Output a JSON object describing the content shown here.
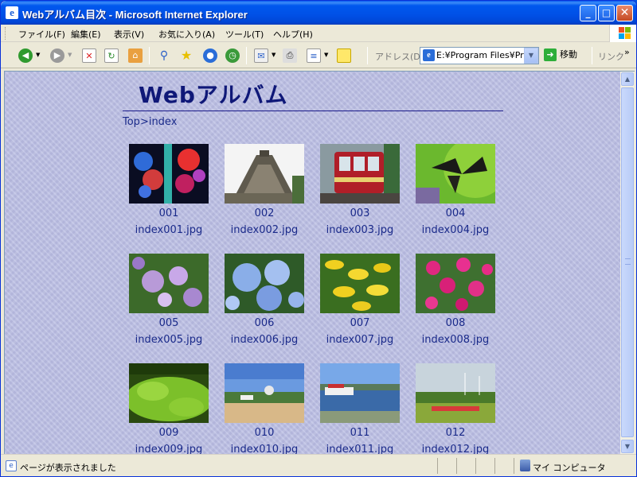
{
  "window": {
    "title": "Webアルバム目次 - Microsoft Internet Explorer",
    "icon": "ie-icon",
    "controls": {
      "minimize": "_",
      "maximize": "□",
      "close": "✕"
    }
  },
  "menu": {
    "items": [
      {
        "label": "ファイル(F)"
      },
      {
        "label": "編集(E)"
      },
      {
        "label": "表示(V)"
      },
      {
        "label": "お気に入り(A)"
      },
      {
        "label": "ツール(T)"
      },
      {
        "label": "ヘルプ(H)"
      }
    ]
  },
  "toolbar": {
    "address_label": "アドレス(D)",
    "address_value": "E:¥Program Files¥Pre",
    "go_label": "移動",
    "links_label": "リンク",
    "more": "»"
  },
  "page": {
    "title": "Webアルバム",
    "breadcrumb": "Top>index",
    "items": [
      {
        "num": "001",
        "file": "index001.jpg",
        "theme": "lights"
      },
      {
        "num": "002",
        "file": "index002.jpg",
        "theme": "pyramid"
      },
      {
        "num": "003",
        "file": "index003.jpg",
        "theme": "tram"
      },
      {
        "num": "004",
        "file": "index004.jpg",
        "theme": "butterfly"
      },
      {
        "num": "005",
        "file": "index005.jpg",
        "theme": "hydrangea-purple"
      },
      {
        "num": "006",
        "file": "index006.jpg",
        "theme": "hydrangea-blue"
      },
      {
        "num": "007",
        "file": "index007.jpg",
        "theme": "yellow-flowers"
      },
      {
        "num": "008",
        "file": "index008.jpg",
        "theme": "petunias"
      },
      {
        "num": "009",
        "file": "index009.jpg",
        "theme": "moss"
      },
      {
        "num": "010",
        "file": "index010.jpg",
        "theme": "park"
      },
      {
        "num": "011",
        "file": "index011.jpg",
        "theme": "lake-boat"
      },
      {
        "num": "012",
        "file": "index012.jpg",
        "theme": "wind-turbines"
      }
    ]
  },
  "status": {
    "text": "ページが表示されました",
    "zone": "マイ コンピュータ"
  },
  "colors": {
    "title_bar": "#0054e3",
    "page_bg": "#bcbfe4",
    "link_text": "#1a2a8a",
    "heading": "#0f1878"
  }
}
